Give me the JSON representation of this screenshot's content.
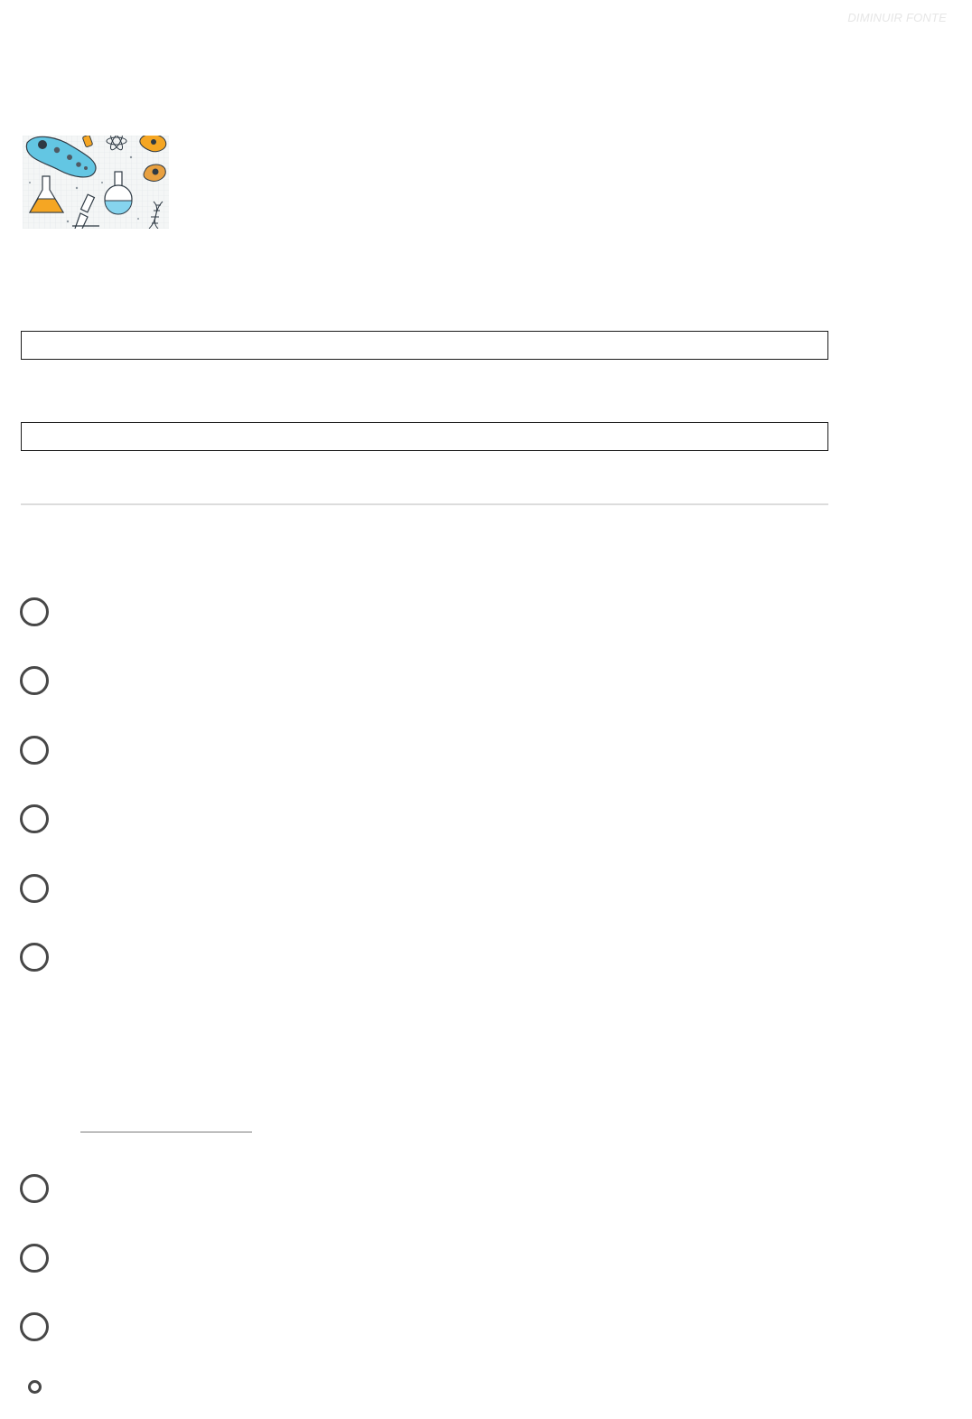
{
  "header": {
    "font_toggle_label": "DIMINUIR FONTE"
  },
  "illustration": {
    "description_icon": "science-doodles-image",
    "colors": {
      "paramecium": "#5cc4e0",
      "orange": "#f5a623",
      "grid": "#e6ebee",
      "ink": "#2f3a44"
    }
  },
  "form": {
    "field_1": {
      "value": "",
      "placeholder": ""
    },
    "field_2": {
      "value": "",
      "placeholder": ""
    }
  },
  "question_1": {
    "options": [
      {
        "label": ""
      },
      {
        "label": ""
      },
      {
        "label": ""
      },
      {
        "label": ""
      },
      {
        "label": ""
      },
      {
        "label": ""
      }
    ]
  },
  "question_2": {
    "options": [
      {
        "label": ""
      },
      {
        "label": ""
      },
      {
        "label": ""
      },
      {
        "label": ""
      }
    ]
  },
  "colors": {
    "radio_border": "#474747",
    "field_border": "#1a1a1a",
    "divider": "#dcdcdc",
    "faint_text": "#e6e6e6"
  }
}
